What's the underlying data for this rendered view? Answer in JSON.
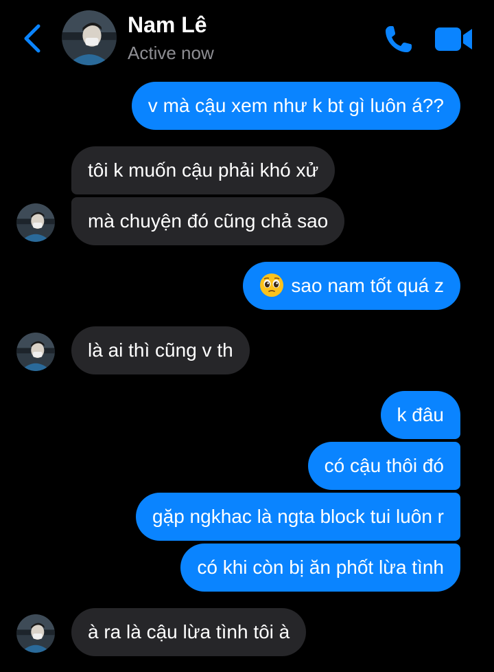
{
  "header": {
    "contact_name": "Nam Lê",
    "status": "Active now",
    "back_icon": "chevron-left-icon",
    "call_icon": "phone-icon",
    "video_icon": "video-camera-icon",
    "accent_color": "#0a84ff"
  },
  "messages": [
    {
      "from": "me",
      "text": "v mà cậu xem như k bt gì luôn á??"
    },
    {
      "from": "them",
      "text": "tôi k muốn cậu phải khó xử"
    },
    {
      "from": "them",
      "text": "mà chuyện đó cũng chả sao"
    },
    {
      "from": "me",
      "text": "sao nam tốt quá z",
      "emoji": "pleading-face-icon"
    },
    {
      "from": "them",
      "text": "là ai thì cũng v th"
    },
    {
      "from": "me",
      "text": "k đâu"
    },
    {
      "from": "me",
      "text": "có cậu thôi đó"
    },
    {
      "from": "me",
      "text": "gặp ngkhac là ngta block tui luôn r"
    },
    {
      "from": "me",
      "text": "có khi còn bị ăn phốt lừa tình"
    },
    {
      "from": "them",
      "text": "à ra là cậu lừa tình tôi à"
    }
  ],
  "colors": {
    "sent_bubble": "#0a84ff",
    "received_bubble": "#262629",
    "background": "#000000",
    "status_text": "#8e8e93"
  }
}
